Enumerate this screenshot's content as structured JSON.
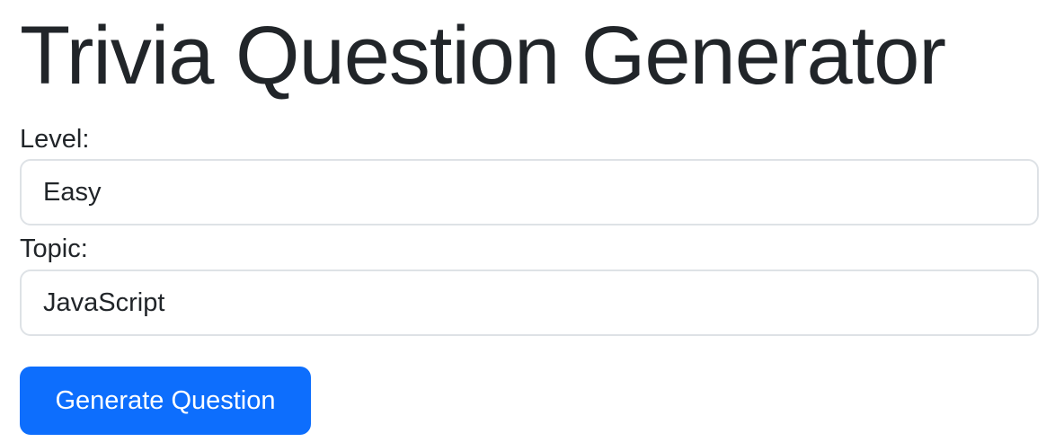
{
  "page": {
    "title": "Trivia Question Generator"
  },
  "form": {
    "level": {
      "label": "Level:",
      "value": "Easy"
    },
    "topic": {
      "label": "Topic:",
      "value": "JavaScript"
    },
    "submit_label": "Generate Question"
  },
  "colors": {
    "button_primary": "#0d6efd",
    "text": "#212529",
    "input_border": "#dee2e6"
  }
}
